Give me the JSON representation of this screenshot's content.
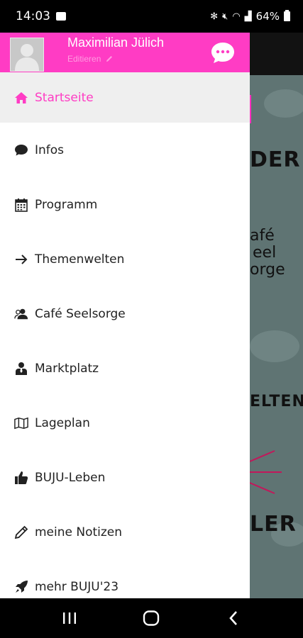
{
  "status_bar": {
    "time": "14:03",
    "battery": "64%",
    "icons": [
      "gallery-icon",
      "bluetooth-icon",
      "mute-icon",
      "wifi-icon",
      "signal-icon",
      "battery-icon"
    ]
  },
  "drawer": {
    "user_name": "Maximilian Jülich",
    "edit_label": "Editieren",
    "menu_items": [
      {
        "label": "Startseite",
        "icon": "home-icon",
        "active": true
      },
      {
        "label": "Infos",
        "icon": "speech-bubble-icon"
      },
      {
        "label": "Programm",
        "icon": "calendar-icon"
      },
      {
        "label": "Themenwelten",
        "icon": "arrow-right-icon"
      },
      {
        "label": "Café Seelsorge",
        "icon": "users-icon"
      },
      {
        "label": "Marktplatz",
        "icon": "person-tie-icon"
      },
      {
        "label": "Lageplan",
        "icon": "map-icon"
      },
      {
        "label": "BUJU-Leben",
        "icon": "thumbs-up-icon"
      },
      {
        "label": "meine Notizen",
        "icon": "pencil-icon"
      },
      {
        "label": "mehr BUJU'23",
        "icon": "rocket-icon"
      }
    ]
  },
  "background_app": {
    "fragments": [
      "DER",
      "afé",
      "eel",
      "orge",
      "ELTEN",
      "LER"
    ]
  },
  "colors": {
    "accent": "#ff3cc4",
    "active_bg": "#efefef",
    "background_app": "#5f7473"
  },
  "nav_bar": {
    "buttons": [
      "recent-apps-icon",
      "home-button-icon",
      "back-icon"
    ]
  }
}
